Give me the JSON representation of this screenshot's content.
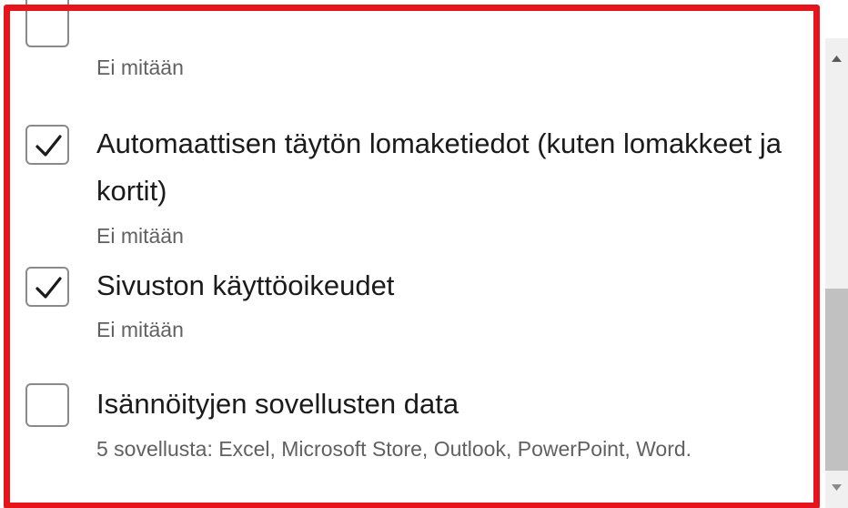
{
  "items": [
    {
      "checked": false,
      "title": "",
      "subtitle": "Ei mitään"
    },
    {
      "checked": true,
      "title": "Automaattisen täytön lomaketiedot (kuten lomakkeet ja kortit)",
      "subtitle": "Ei mitään"
    },
    {
      "checked": true,
      "title": "Sivuston käyttöoikeudet",
      "subtitle": "Ei mitään"
    },
    {
      "checked": false,
      "title": "Isännöityjen sovellusten data",
      "subtitle": "5 sovellusta: Excel, Microsoft Store, Outlook, PowerPoint, Word."
    }
  ],
  "colors": {
    "highlight_border": "#e8141c",
    "checkmark": "#1b1b1b",
    "checkbox_border": "#8a8a8a",
    "scrollbar_track": "#f0f0f0",
    "scrollbar_thumb": "#c1c1c1"
  },
  "icons": {
    "check": "checkmark-icon",
    "scroll_up": "scroll-up-arrow-icon",
    "scroll_down": "scroll-down-arrow-icon"
  }
}
